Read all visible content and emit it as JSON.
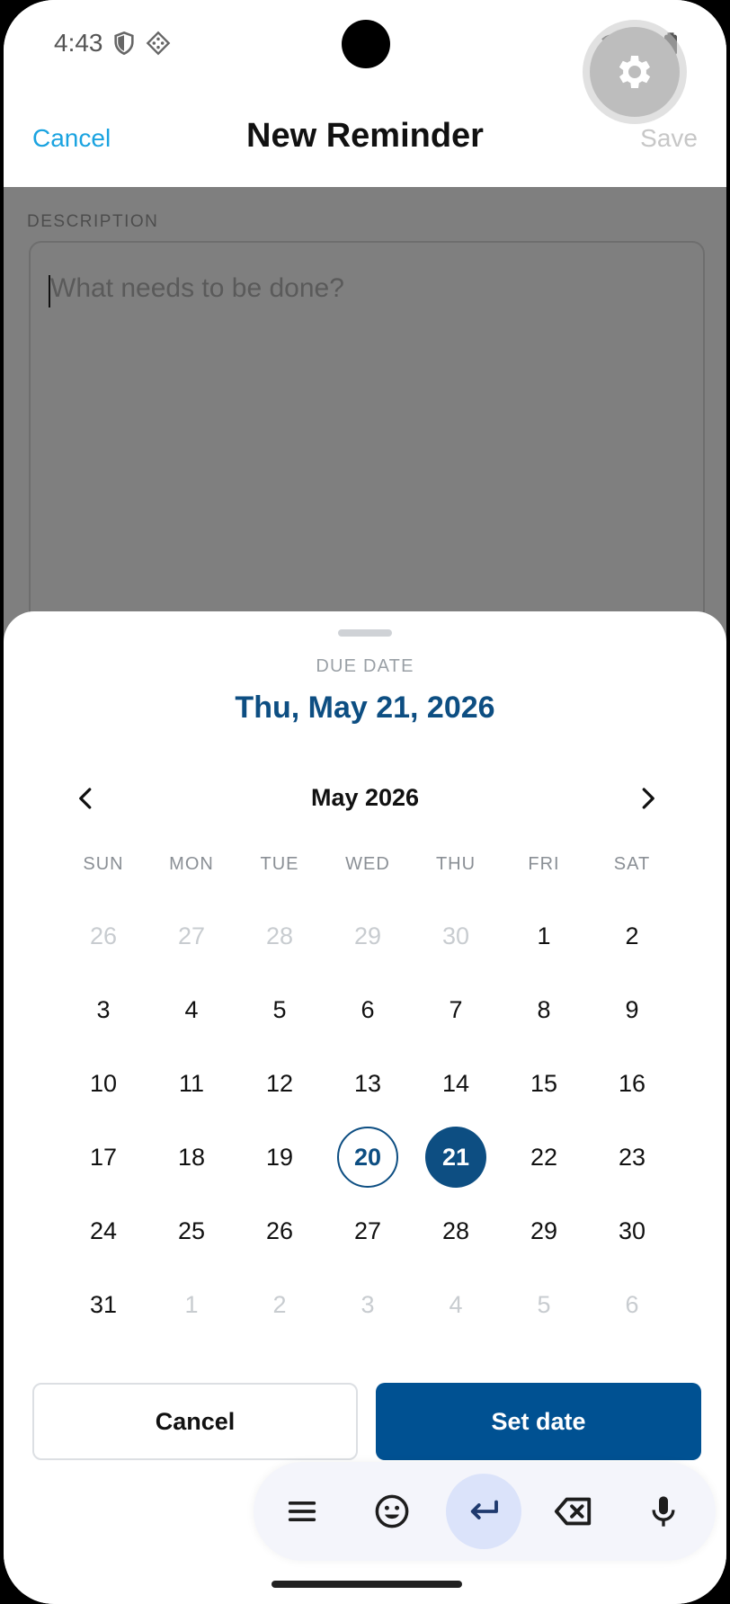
{
  "status_bar": {
    "time": "4:43",
    "icons": [
      "shield-icon",
      "vpn-diamond-icon",
      "wifi-icon",
      "signal-icon",
      "battery-icon"
    ]
  },
  "header": {
    "cancel_label": "Cancel",
    "title": "New Reminder",
    "save_label": "Save"
  },
  "description": {
    "label": "DESCRIPTION",
    "placeholder": "What needs to be done?"
  },
  "due_date_sheet": {
    "label": "DUE DATE",
    "selected_text": "Thu, May 21, 2026",
    "month_title": "May 2026",
    "weekdays": [
      "SUN",
      "MON",
      "TUE",
      "WED",
      "THU",
      "FRI",
      "SAT"
    ],
    "weeks": [
      [
        "26",
        "27",
        "28",
        "29",
        "30",
        "1",
        "2"
      ],
      [
        "3",
        "4",
        "5",
        "6",
        "7",
        "8",
        "9"
      ],
      [
        "10",
        "11",
        "12",
        "13",
        "14",
        "15",
        "16"
      ],
      [
        "17",
        "18",
        "19",
        "20",
        "21",
        "22",
        "23"
      ],
      [
        "24",
        "25",
        "26",
        "27",
        "28",
        "29",
        "30"
      ],
      [
        "31",
        "1",
        "2",
        "3",
        "4",
        "5",
        "6"
      ]
    ],
    "cancel_label": "Cancel",
    "set_label": "Set date",
    "accent_color": "#005192"
  },
  "keyboard_toolbar": {
    "keys": [
      "menu-icon",
      "emoji-icon",
      "enter-icon",
      "backspace-icon",
      "microphone-icon"
    ]
  }
}
